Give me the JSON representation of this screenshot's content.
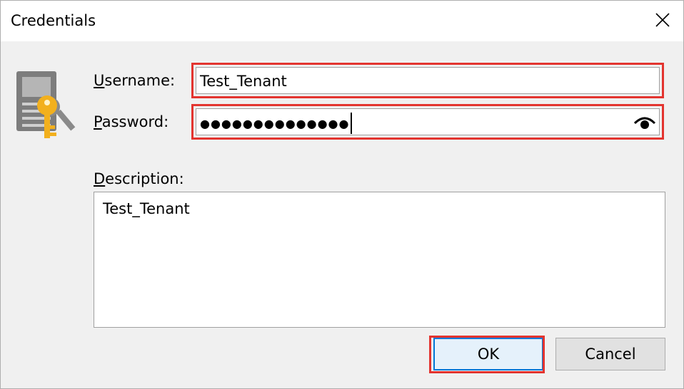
{
  "window": {
    "title": "Credentials"
  },
  "form": {
    "username_label_mnemonic": "U",
    "username_label_rest": "sername:",
    "username_value": "Test_Tenant",
    "password_label_mnemonic": "P",
    "password_label_rest": "assword:",
    "password_mask": "●●●●●●●●●●●●●●",
    "description_label_mnemonic": "D",
    "description_label_rest": "escription:",
    "description_value": "Test_Tenant"
  },
  "buttons": {
    "ok": "OK",
    "cancel": "Cancel"
  },
  "icons": {
    "app": "credentials-key-icon",
    "close": "close-icon",
    "reveal": "eye-icon"
  },
  "colors": {
    "highlight": "#e3342f",
    "ok_focus": "#0078d7"
  }
}
